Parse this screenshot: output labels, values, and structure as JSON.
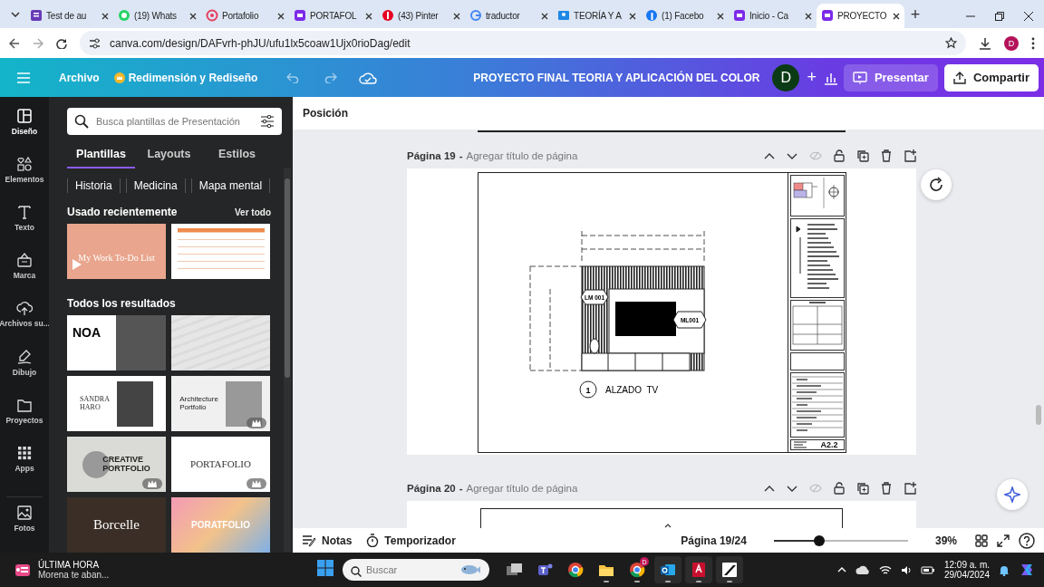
{
  "browser": {
    "tabs": [
      {
        "title": "Test de au",
        "kind": "forms",
        "selected": false
      },
      {
        "title": "(19) Whats",
        "kind": "chat",
        "selected": false
      },
      {
        "title": "Portafolio",
        "kind": "ring",
        "selected": false
      },
      {
        "title": "PORTAFOL",
        "kind": "canva",
        "selected": false
      },
      {
        "title": "(43) Pinter",
        "kind": "pin",
        "selected": false
      },
      {
        "title": "traductor",
        "kind": "google",
        "selected": false
      },
      {
        "title": "TEORÍA Y A",
        "kind": "classroom",
        "selected": false
      },
      {
        "title": "(1) Facebo",
        "kind": "facebook",
        "selected": false
      },
      {
        "title": "Inicio - Ca",
        "kind": "canva",
        "selected": false
      },
      {
        "title": "PROYECTO",
        "kind": "canva",
        "selected": true
      }
    ],
    "new_tab": "+",
    "url": "canva.com/design/DAFvrh-phJU/ufu1lx5coaw1Ujx0rioDag/edit",
    "profile": "D"
  },
  "toolbar": {
    "file_menu": "Archivo",
    "resize": "Redimensión y Rediseño",
    "title": "PROYECTO FINAL TEORIA Y APLICACIÓN DEL COLOR",
    "avatar": "D",
    "add": "+",
    "present": "Presentar",
    "share": "Compartir"
  },
  "rail": [
    {
      "label": "Diseño",
      "kind": "design",
      "selected": true
    },
    {
      "label": "Elementos",
      "kind": "elements",
      "selected": false
    },
    {
      "label": "Texto",
      "kind": "text",
      "selected": false
    },
    {
      "label": "Marca",
      "kind": "brand",
      "selected": false
    },
    {
      "label": "Archivos su...",
      "kind": "upload",
      "selected": false
    },
    {
      "label": "Dibujo",
      "kind": "draw",
      "selected": false
    },
    {
      "label": "Proyectos",
      "kind": "projects",
      "selected": false
    },
    {
      "label": "Apps",
      "kind": "apps",
      "selected": false
    },
    {
      "label": "Fotos",
      "kind": "photos",
      "selected": false
    }
  ],
  "panel": {
    "search": {
      "placeholder": "Busca plantillas de Presentación"
    },
    "tabs": [
      {
        "label": "Plantillas",
        "selected": true
      },
      {
        "label": "Layouts",
        "selected": false
      },
      {
        "label": "Estilos",
        "selected": false
      }
    ],
    "chips": [
      "Historia",
      "Medicina",
      "Mapa mental"
    ],
    "recent_heading": "Usado recientemente",
    "see_all": "Ver todo",
    "recent": [
      {
        "kind": "video",
        "lines": [
          "My Work To-Do List"
        ],
        "premium": false
      },
      {
        "kind": "schedule",
        "premium": false
      }
    ],
    "results_heading": "Todos los resultados",
    "results": [
      {
        "kind": "collage",
        "lines": [
          "NOA"
        ],
        "premium": false
      },
      {
        "kind": "texture",
        "premium": false
      },
      {
        "kind": "portrait",
        "lines": [
          "SANDRA",
          "HARO"
        ],
        "premium": false
      },
      {
        "kind": "architecture",
        "lines": [
          "Architecture",
          "Portfolio"
        ],
        "premium": true
      },
      {
        "kind": "circle",
        "lines": [
          "CREATIVE",
          "PORTFOLIO"
        ],
        "premium": true
      },
      {
        "kind": "plain",
        "lines": [
          "PORTAFOLIO"
        ],
        "premium": true
      },
      {
        "kind": "dark",
        "lines": [
          "Borcelle"
        ],
        "premium": false
      },
      {
        "kind": "gradient",
        "lines": [
          "PORATFOLIO"
        ],
        "premium": false
      }
    ]
  },
  "canvas": {
    "context_label": "Posición",
    "pages": [
      {
        "number": "Página 19",
        "separator": "-",
        "title_placeholder": "Agregar título de página",
        "kind": "sheet",
        "sheet": {
          "tags": [
            "LM 001",
            "ML001"
          ],
          "view_number": "1",
          "view_title": "ALZADO  TV",
          "sheet_number": "A2.2"
        }
      },
      {
        "number": "Página 20",
        "separator": "-",
        "title_placeholder": "Agregar título de página",
        "kind": "partial"
      }
    ]
  },
  "bottom_bar": {
    "notes": "Notas",
    "timer": "Temporizador",
    "page_indicator": "Página 19/24",
    "zoom": {
      "level": 0.34
    },
    "zoom_reading": "39%"
  },
  "taskbar": {
    "news": {
      "headline": "ÚLTIMA HORA",
      "text": "Morena te aban..."
    },
    "search": {
      "placeholder": "Buscar"
    },
    "apps": [
      {
        "kind": "task-view",
        "running": false
      },
      {
        "kind": "teams",
        "running": false
      },
      {
        "kind": "chrome",
        "running": false
      },
      {
        "kind": "files",
        "running": true
      },
      {
        "kind": "chrome",
        "running": true,
        "badge": "D"
      },
      {
        "kind": "outlook",
        "running": true
      },
      {
        "kind": "autocad",
        "running": true
      },
      {
        "kind": "autodesk",
        "running": true
      }
    ],
    "time": "12:09 a. m.",
    "date": "29/04/2024"
  }
}
